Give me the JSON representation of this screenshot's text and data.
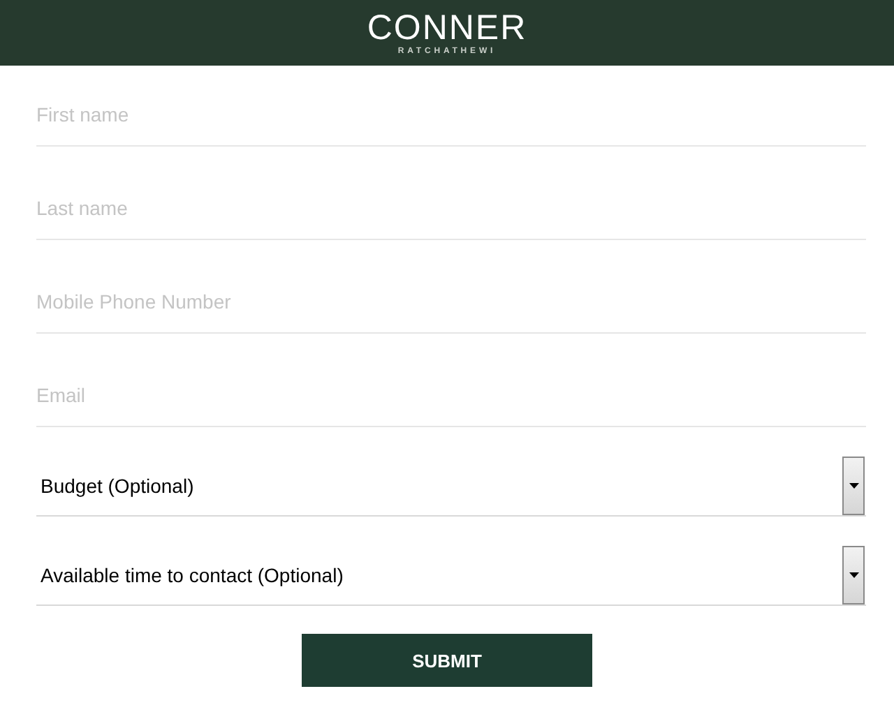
{
  "header": {
    "logo": "CONNER",
    "subtitle": "RATCHATHEWI"
  },
  "fields": [
    {
      "placeholder": "First name"
    },
    {
      "placeholder": "Last name"
    },
    {
      "placeholder": "Mobile Phone Number"
    },
    {
      "placeholder": "Email"
    }
  ],
  "dropdowns": [
    {
      "value": "Budget (Optional)"
    },
    {
      "value": "Available time to contact (Optional)"
    }
  ],
  "submit": "SUBMIT"
}
